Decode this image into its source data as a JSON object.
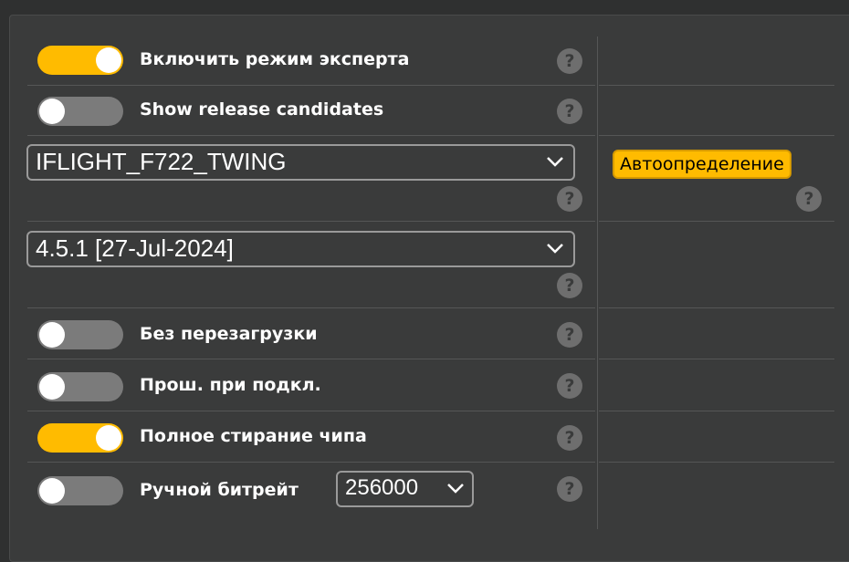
{
  "options": {
    "expert_mode": {
      "label": "Включить режим эксперта",
      "enabled": true
    },
    "show_release_candidates": {
      "label": "Show release candidates",
      "enabled": false
    },
    "no_reboot": {
      "label": "Без перезагрузки",
      "enabled": false
    },
    "flash_on_connect": {
      "label": "Прош. при подкл.",
      "enabled": false
    },
    "full_chip_erase": {
      "label": "Полное стирание чипа",
      "enabled": true
    },
    "manual_baud": {
      "label": "Ручной битрейт",
      "enabled": false
    }
  },
  "board_select": {
    "value": "IFLIGHT_F722_TWING"
  },
  "autodetect_button": {
    "label": "Автоопределение"
  },
  "firmware_select": {
    "value": "4.5.1 [27-Jul-2024]"
  },
  "baud_select": {
    "value": "256000"
  },
  "help": {
    "glyph": "?"
  },
  "colors": {
    "accent": "#ffbb00",
    "toggle_off": "#7b7b7b",
    "panel": "#3a3b3b"
  }
}
